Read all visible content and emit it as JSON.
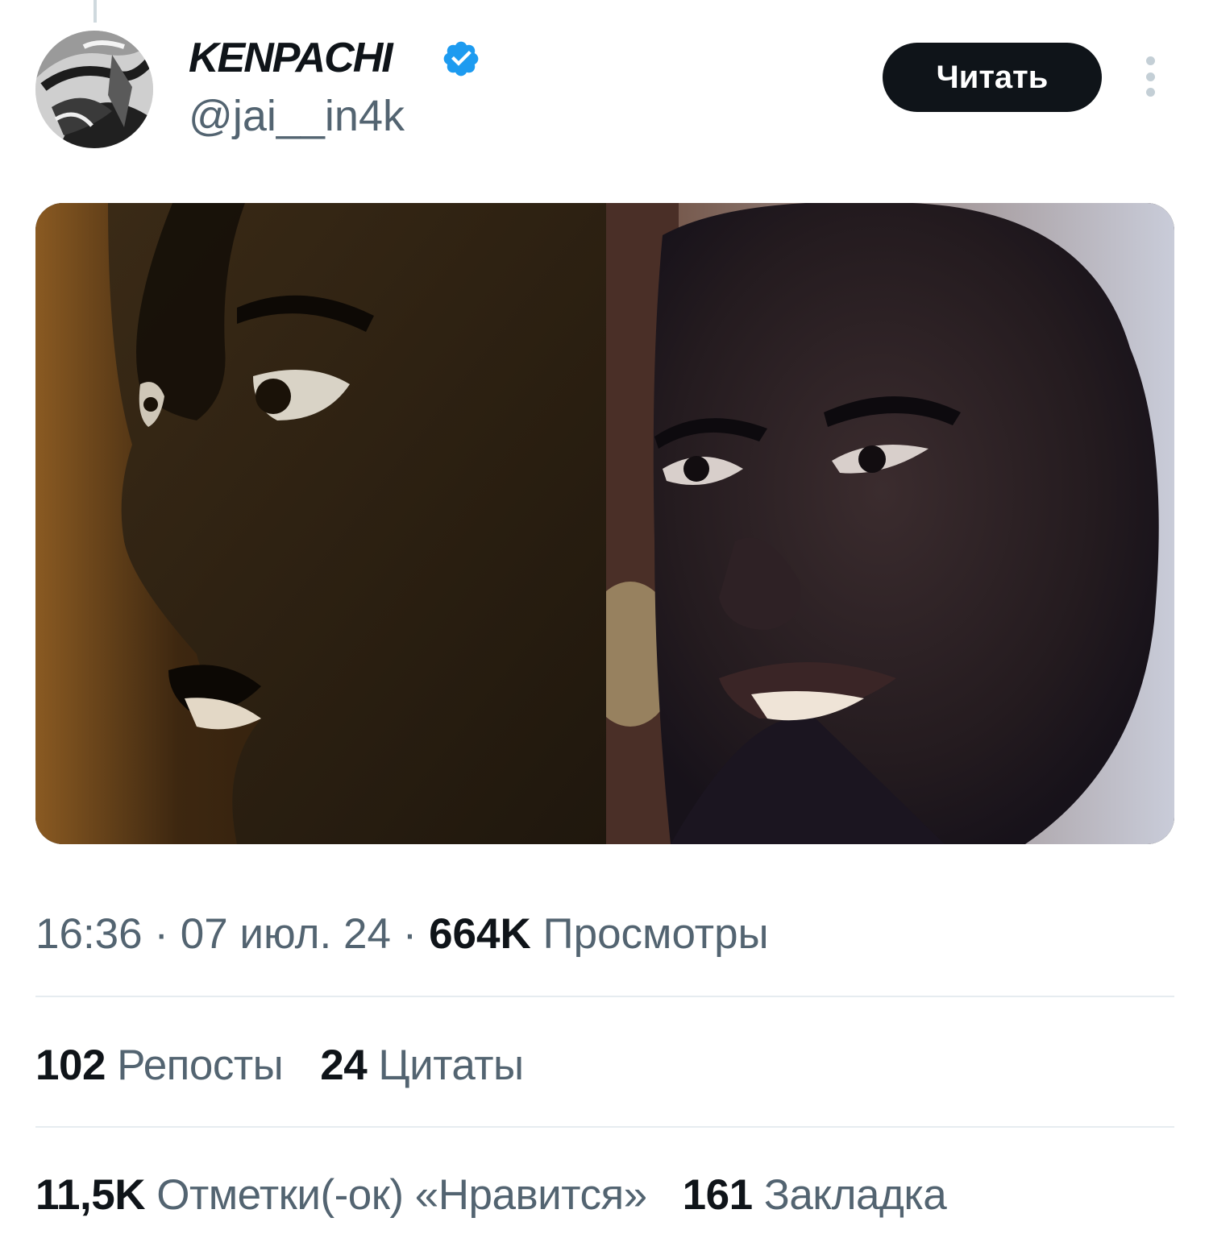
{
  "tweet": {
    "author": {
      "display_name": "KENPACHI",
      "handle": "@jai__in4k",
      "verified": true
    },
    "follow_label": "Читать",
    "meta": {
      "time": "16:36",
      "separator": " · ",
      "date": "07 июл. 24",
      "views_count": "664K",
      "views_label": "Просмотры"
    },
    "stats": {
      "reposts_count": "102",
      "reposts_label": "Репосты",
      "quotes_count": "24",
      "quotes_label": "Цитаты",
      "likes_count": "11,5K",
      "likes_label": "Отметки(-ок) «Нравится»",
      "bookmarks_count": "161",
      "bookmarks_label": "Закладка"
    }
  },
  "colors": {
    "text_primary": "#0f1419",
    "text_secondary": "#536471",
    "verified_blue": "#1d9bf0",
    "follow_bg": "#0f1419",
    "divider": "#e6ecf0"
  },
  "icons": {
    "verified": "verified-badge-icon",
    "more": "more-dots-icon"
  }
}
